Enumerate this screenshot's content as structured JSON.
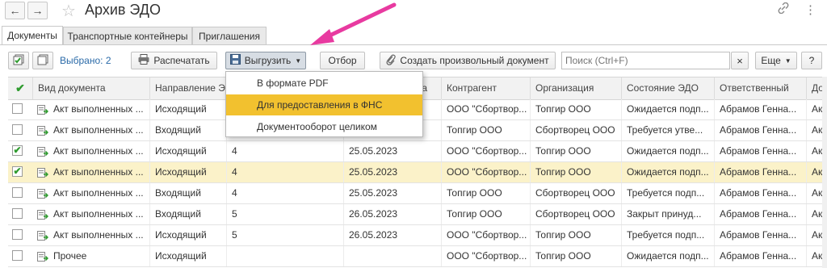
{
  "window": {
    "title": "Архив ЭДО",
    "back_icon": "←",
    "forward_icon": "→",
    "link_icon": "🔗",
    "more_icon": "⋮"
  },
  "tabs": [
    {
      "label": "Документы",
      "active": true
    },
    {
      "label": "Транспортные контейнеры",
      "active": false
    },
    {
      "label": "Приглашения",
      "active": false
    }
  ],
  "toolbar": {
    "selected_label": "Выбрано: 2",
    "print_label": "Распечатать",
    "export_label": "Выгрузить",
    "selection_label": "Отбор",
    "create_label": "Создать произвольный документ",
    "search_placeholder": "Поиск (Ctrl+F)",
    "clear_icon": "×",
    "more_label": "Еще",
    "help_label": "?"
  },
  "export_menu": {
    "items": [
      "В формате PDF",
      "Для предоставления в ФНС",
      "Документооборот целиком"
    ],
    "highlighted": 1
  },
  "table": {
    "columns": [
      "Вид документа",
      "Направление Э",
      "",
      "та",
      "Контрагент",
      "Организация",
      "Состояние ЭДО",
      "Ответственный",
      "Док"
    ],
    "rows": [
      {
        "checked": false,
        "highlight": false,
        "cells": [
          "Акт выполненных ...",
          "Исходящий",
          "",
          "",
          "ООО \"Сбортвор...",
          "Топгир ООО",
          "Ожидается подп...",
          "Абрамов Генна...",
          "Акт"
        ]
      },
      {
        "checked": false,
        "highlight": false,
        "cells": [
          "Акт выполненных ...",
          "Входящий",
          "",
          "",
          "Топгир ООО",
          "Сбортворец ООО",
          "Требуется утве...",
          "Абрамов Генна...",
          "Акт"
        ]
      },
      {
        "checked": true,
        "highlight": false,
        "cells": [
          "Акт выполненных ...",
          "Исходящий",
          "4",
          "25.05.2023",
          "ООО \"Сбортвор...",
          "Топгир ООО",
          "Ожидается подп...",
          "Абрамов Генна...",
          "Акт"
        ]
      },
      {
        "checked": true,
        "highlight": true,
        "cells": [
          "Акт выполненных ...",
          "Исходящий",
          "4",
          "25.05.2023",
          "ООО \"Сбортвор...",
          "Топгир ООО",
          "Ожидается подп...",
          "Абрамов Генна...",
          "Акт"
        ]
      },
      {
        "checked": false,
        "highlight": false,
        "cells": [
          "Акт выполненных ...",
          "Входящий",
          "4",
          "25.05.2023",
          "Топгир ООО",
          "Сбортворец ООО",
          "Требуется подп...",
          "Абрамов Генна...",
          "Акт"
        ]
      },
      {
        "checked": false,
        "highlight": false,
        "cells": [
          "Акт выполненных ...",
          "Входящий",
          "5",
          "26.05.2023",
          "Топгир ООО",
          "Сбортворец ООО",
          "Закрыт принуд...",
          "Абрамов Генна...",
          "Акт"
        ]
      },
      {
        "checked": false,
        "highlight": false,
        "cells": [
          "Акт выполненных ...",
          "Исходящий",
          "5",
          "26.05.2023",
          "ООО \"Сбортвор...",
          "Топгир ООО",
          "Требуется подп...",
          "Абрамов Генна...",
          "Акт"
        ]
      },
      {
        "checked": false,
        "highlight": false,
        "cells": [
          "Прочее",
          "Исходящий",
          "",
          "",
          "ООО \"Сбортвор...",
          "Топгир ООО",
          "Ожидается подп...",
          "Абрамов Генна...",
          "Акт"
        ]
      }
    ]
  },
  "colors": {
    "accent_blue": "#2a6aa8",
    "highlight_row": "#fbf2c9",
    "menu_hover": "#f2c12f",
    "annotation_arrow": "#e83aa0",
    "check_green": "#2f9b2f"
  }
}
